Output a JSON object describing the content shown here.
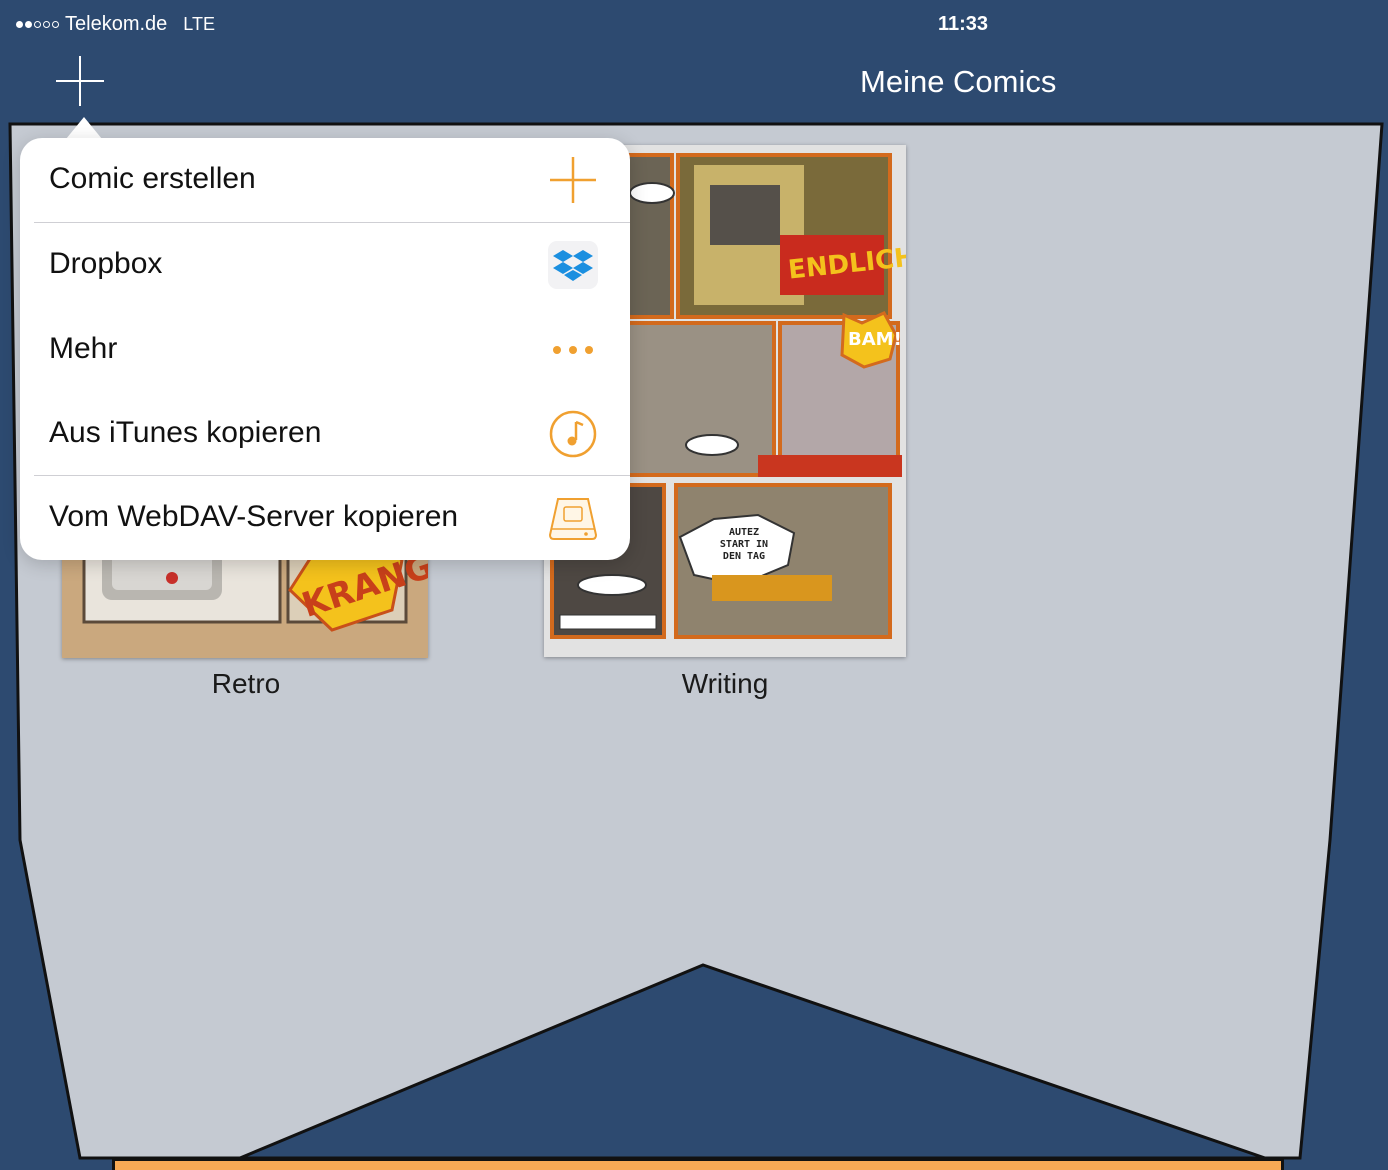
{
  "status_bar": {
    "carrier": "Telekom.de",
    "network": "LTE",
    "time": "11:33"
  },
  "nav_bar": {
    "title": "Meine Comics",
    "add_icon": "plus-icon"
  },
  "comics": [
    {
      "title": "Retro",
      "thumbnail": "retro-comic-thumbnail"
    },
    {
      "title": "Writing",
      "thumbnail": "writing-comic-thumbnail"
    }
  ],
  "thumbnail_text": {
    "retro_sfx": "KRANG",
    "endlich": "ENDLICH",
    "bam": "BAM!",
    "speech_lines": [
      "AUTEZ",
      "START IN",
      "DEN TAG"
    ]
  },
  "popover_menu": {
    "items": [
      {
        "label": "Comic erstellen",
        "icon": "plus-icon"
      },
      {
        "label": "Dropbox",
        "icon": "dropbox-icon"
      },
      {
        "label": "Mehr",
        "icon": "more-dots-icon"
      },
      {
        "label": "Aus iTunes kopieren",
        "icon": "itunes-icon"
      },
      {
        "label": "Vom WebDAV-Server kopieren",
        "icon": "webdav-server-icon"
      }
    ]
  },
  "colors": {
    "frame_blue": "#2d4a70",
    "content_gray": "#c5cad2",
    "accent_orange": "#f0a030",
    "dropbox_blue": "#1a8fe0",
    "bottom_banner": "#f7a955"
  }
}
